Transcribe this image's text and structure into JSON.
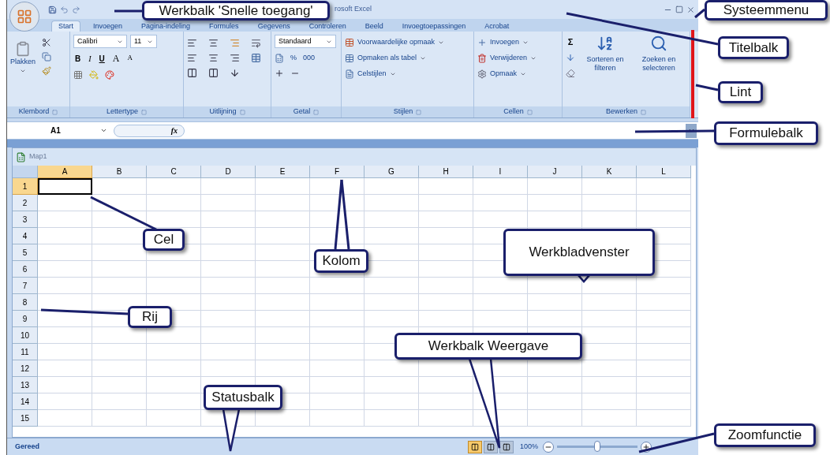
{
  "title_bar": {
    "title": "rosoft Excel"
  },
  "ribbon_tabs": [
    {
      "label": "Start",
      "selected": true
    },
    {
      "label": "Invoegen",
      "selected": false
    },
    {
      "label": "Pagina-indeling",
      "selected": false
    },
    {
      "label": "Formules",
      "selected": false
    },
    {
      "label": "Gegevens",
      "selected": false
    },
    {
      "label": "Controleren",
      "selected": false
    },
    {
      "label": "Beeld",
      "selected": false
    },
    {
      "label": "Invoegtoepassingen",
      "selected": false
    },
    {
      "label": "Acrobat",
      "selected": false
    }
  ],
  "ribbon": {
    "clipboard": {
      "label": "Klembord",
      "paste": "Plakken"
    },
    "font": {
      "label": "Lettertype",
      "font_name": "Calibri",
      "font_size": "11",
      "buttons": [
        "B",
        "I",
        "U",
        "A",
        "A"
      ]
    },
    "alignment": {
      "label": "Uitlijning"
    },
    "number": {
      "label": "Getal",
      "format": "Standaard",
      "buttons": [
        "%",
        "000"
      ]
    },
    "styles": {
      "label": "Stijlen",
      "commands": [
        "Voorwaardelijke opmaak",
        "Opmaken als tabel",
        "Celstijlen"
      ]
    },
    "cells": {
      "label": "Cellen",
      "commands": [
        "Invoegen",
        "Verwijderen",
        "Opmaak"
      ]
    },
    "editing": {
      "label": "Bewerken",
      "sum": "Σ",
      "commands": [
        "Sorteren en filteren",
        "Zoeken en selecteren"
      ]
    }
  },
  "formula_bar": {
    "name_box": "A1",
    "function_label": "fx"
  },
  "workbook": {
    "title": "Map1",
    "columns": [
      {
        "label": "A",
        "selected": true
      },
      {
        "label": "B",
        "selected": false
      },
      {
        "label": "C",
        "selected": false
      },
      {
        "label": "D",
        "selected": false
      },
      {
        "label": "E",
        "selected": false
      },
      {
        "label": "F",
        "selected": false
      },
      {
        "label": "G",
        "selected": false
      },
      {
        "label": "H",
        "selected": false
      },
      {
        "label": "I",
        "selected": false
      },
      {
        "label": "J",
        "selected": false
      },
      {
        "label": "K",
        "selected": false
      },
      {
        "label": "L",
        "selected": false
      }
    ],
    "rows": [
      {
        "label": "1",
        "selected": true
      },
      {
        "label": "2",
        "selected": false
      },
      {
        "label": "3",
        "selected": false
      },
      {
        "label": "4",
        "selected": false
      },
      {
        "label": "5",
        "selected": false
      },
      {
        "label": "6",
        "selected": false
      },
      {
        "label": "7",
        "selected": false
      },
      {
        "label": "8",
        "selected": false
      },
      {
        "label": "9",
        "selected": false
      },
      {
        "label": "10",
        "selected": false
      },
      {
        "label": "11",
        "selected": false
      },
      {
        "label": "12",
        "selected": false
      },
      {
        "label": "13",
        "selected": false
      },
      {
        "label": "14",
        "selected": false
      },
      {
        "label": "15",
        "selected": false
      }
    ]
  },
  "status_bar": {
    "status": "Gereed",
    "views": [
      {
        "selected": true
      },
      {
        "selected": false
      },
      {
        "selected": false
      }
    ],
    "zoom": "100%",
    "zoom_slider": {
      "level": 0.5
    }
  },
  "callouts": [
    {
      "text": "Werkbalk 'Snelle toegang'"
    },
    {
      "text": "Systeemmenu"
    },
    {
      "text": "Titelbalk"
    },
    {
      "text": "Lint"
    },
    {
      "text": "Formulebalk"
    },
    {
      "text": "Cel"
    },
    {
      "text": "Kolom"
    },
    {
      "text": "Werkbladvenster"
    },
    {
      "text": "Rij"
    },
    {
      "text": "Werkbalk Weergave"
    },
    {
      "text": "Statusbalk"
    },
    {
      "text": "Zoomfunctie"
    }
  ]
}
